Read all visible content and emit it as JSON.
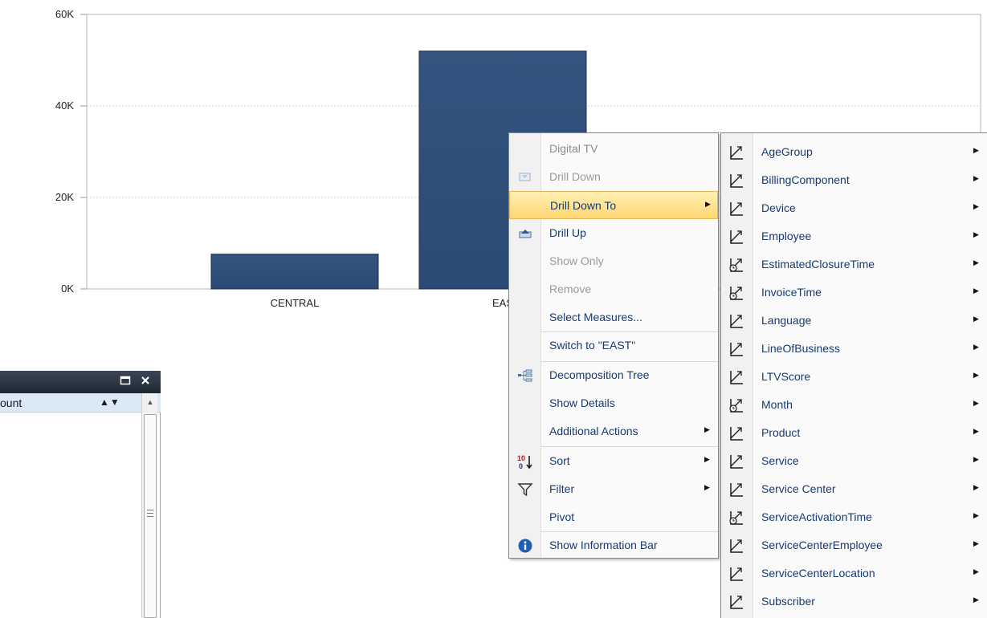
{
  "chart_data": {
    "type": "bar",
    "categories": [
      "CENTRAL",
      "EAST"
    ],
    "values": [
      7600,
      52000
    ],
    "ylim": [
      0,
      60000
    ],
    "yticks": [
      0,
      20000,
      40000,
      60000
    ],
    "ytick_labels": [
      "0K",
      "20K",
      "40K",
      "60K"
    ],
    "xtick_labels": [
      "CENTRAL",
      "EAS"
    ],
    "grid": true,
    "bar_color": "#2b4a74"
  },
  "pane": {
    "column_label": "ount",
    "sort_arrows": "▲▼",
    "maximize_icon": "maximize-icon",
    "close_icon": "close-icon"
  },
  "context_menu": {
    "header": "Digital TV",
    "items": [
      {
        "label": "Drill Down",
        "icon": "drill-down-icon",
        "disabled": true,
        "submenu": false
      },
      {
        "label": "Drill Down To",
        "icon": "",
        "disabled": false,
        "submenu": true,
        "highlighted": true
      },
      {
        "label": "Drill Up",
        "icon": "drill-up-icon",
        "disabled": false,
        "submenu": false
      },
      {
        "label": "Show Only",
        "icon": "",
        "disabled": true,
        "submenu": false
      },
      {
        "label": "Remove",
        "icon": "",
        "disabled": true,
        "submenu": false
      },
      {
        "label": "Select Measures...",
        "icon": "",
        "disabled": false,
        "submenu": false
      },
      {
        "label": "Switch to \"EAST\"",
        "icon": "",
        "disabled": false,
        "submenu": false
      },
      {
        "label": "Decomposition Tree",
        "icon": "decomposition-tree-icon",
        "disabled": false,
        "submenu": false
      },
      {
        "label": "Show Details",
        "icon": "",
        "disabled": false,
        "submenu": false
      },
      {
        "label": "Additional Actions",
        "icon": "",
        "disabled": false,
        "submenu": true
      },
      {
        "label": "Sort",
        "icon": "sort-icon",
        "disabled": false,
        "submenu": true
      },
      {
        "label": "Filter",
        "icon": "filter-icon",
        "disabled": false,
        "submenu": true
      },
      {
        "label": "Pivot",
        "icon": "",
        "disabled": false,
        "submenu": false
      },
      {
        "label": "Show Information Bar",
        "icon": "info-icon",
        "disabled": false,
        "submenu": false
      }
    ]
  },
  "submenu": {
    "items": [
      {
        "label": "AgeGroup",
        "icon": "hierarchy-icon"
      },
      {
        "label": "BillingComponent",
        "icon": "hierarchy-icon"
      },
      {
        "label": "Device",
        "icon": "hierarchy-icon"
      },
      {
        "label": "Employee",
        "icon": "hierarchy-icon"
      },
      {
        "label": "EstimatedClosureTime",
        "icon": "time-hierarchy-icon"
      },
      {
        "label": "InvoiceTime",
        "icon": "time-hierarchy-icon"
      },
      {
        "label": "Language",
        "icon": "hierarchy-icon"
      },
      {
        "label": "LineOfBusiness",
        "icon": "hierarchy-icon"
      },
      {
        "label": "LTVScore",
        "icon": "hierarchy-icon"
      },
      {
        "label": "Month",
        "icon": "time-hierarchy-icon"
      },
      {
        "label": "Product",
        "icon": "hierarchy-icon"
      },
      {
        "label": "Service",
        "icon": "hierarchy-icon"
      },
      {
        "label": "Service Center",
        "icon": "hierarchy-icon"
      },
      {
        "label": "ServiceActivationTime",
        "icon": "time-hierarchy-icon"
      },
      {
        "label": "ServiceCenterEmployee",
        "icon": "hierarchy-icon"
      },
      {
        "label": "ServiceCenterLocation",
        "icon": "hierarchy-icon"
      },
      {
        "label": "Subscriber",
        "icon": "hierarchy-icon"
      }
    ]
  }
}
